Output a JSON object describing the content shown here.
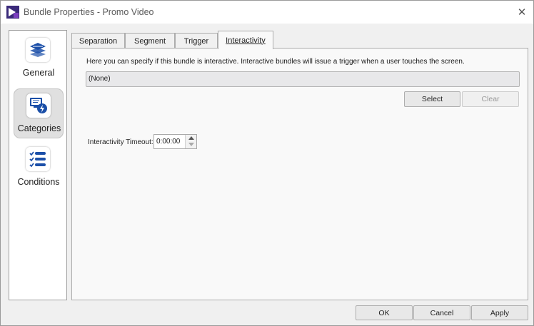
{
  "window": {
    "title": "Bundle Properties - Promo Video",
    "close_glyph": "✕"
  },
  "sidebar": {
    "items": [
      {
        "label": "General",
        "icon": "layers-icon",
        "selected": false
      },
      {
        "label": "Categories",
        "icon": "monitor-lightning-icon",
        "selected": true
      },
      {
        "label": "Conditions",
        "icon": "checklist-icon",
        "selected": false
      }
    ]
  },
  "tabs": [
    {
      "label": "Separation",
      "active": false
    },
    {
      "label": "Segment",
      "active": false
    },
    {
      "label": "Trigger",
      "active": false
    },
    {
      "label": "Interactivity",
      "active": true
    }
  ],
  "interactivity": {
    "description": "Here you can specify if this bundle is interactive. Interactive bundles will issue a trigger when a user touches the screen.",
    "trigger_value": "(None)",
    "select_label": "Select",
    "clear_label": "Clear",
    "timeout_label": "Interactivity Timeout:",
    "timeout_value": "0:00:00"
  },
  "footer": {
    "ok_label": "OK",
    "cancel_label": "Cancel",
    "apply_label": "Apply"
  },
  "colors": {
    "accent": "#1b4fa8",
    "titlebar": "#ffffff",
    "dialog_bg": "#f0f0f0"
  }
}
